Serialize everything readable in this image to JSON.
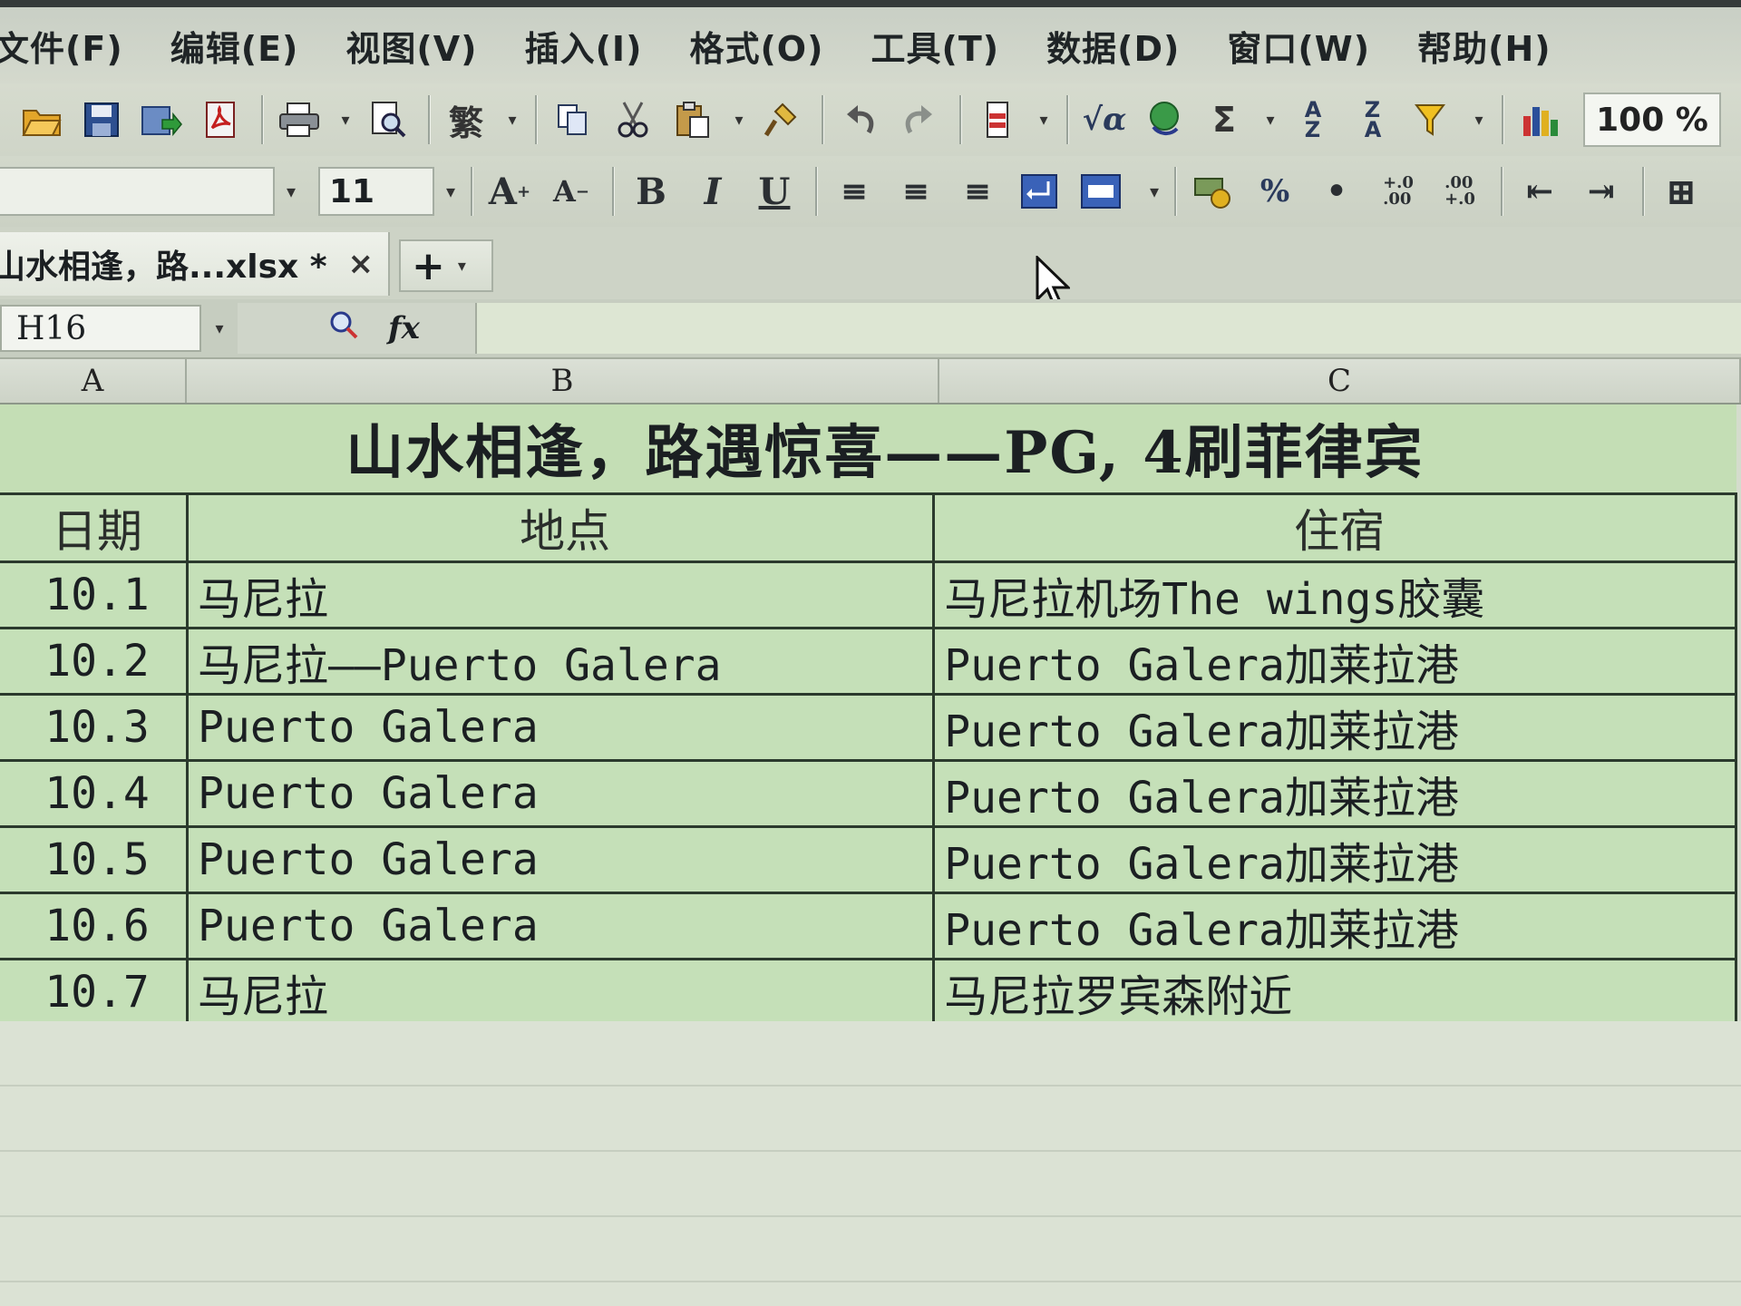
{
  "menu": {
    "items": [
      "文件(F)",
      "编辑(E)",
      "视图(V)",
      "插入(I)",
      "格式(O)",
      "工具(T)",
      "数据(D)",
      "窗口(W)",
      "帮助(H)"
    ]
  },
  "toolbar": {
    "traditional_label": "繁",
    "sigma_label": "Σ",
    "zoom": "100 %"
  },
  "format_toolbar": {
    "font_name": "",
    "font_size": "11",
    "bold_label": "B",
    "italic_label": "I",
    "underline_label": "U",
    "percent_label": "%"
  },
  "tab": {
    "title": "山水相逢，路...xlsx *",
    "close_label": "×",
    "new_label": "+"
  },
  "formula_bar": {
    "cell_ref": "H16",
    "fx_label": "fx",
    "content": ""
  },
  "columns": [
    "A",
    "B",
    "C"
  ],
  "sheet": {
    "title": "山水相逢，路遇惊喜——PG, 4刷菲律宾",
    "headers": [
      "日期",
      "地点",
      "住宿"
    ],
    "rows": [
      {
        "date": "10.1",
        "place": "马尼拉",
        "stay": "马尼拉机场The wings胶囊"
      },
      {
        "date": "10.2",
        "place": "马尼拉——Puerto Galera",
        "stay": "Puerto Galera加莱拉港"
      },
      {
        "date": "10.3",
        "place": "Puerto Galera",
        "stay": "Puerto Galera加莱拉港"
      },
      {
        "date": "10.4",
        "place": "Puerto Galera",
        "stay": "Puerto Galera加莱拉港"
      },
      {
        "date": "10.5",
        "place": "Puerto Galera",
        "stay": "Puerto Galera加莱拉港"
      },
      {
        "date": "10.6",
        "place": "Puerto Galera",
        "stay": "Puerto Galera加莱拉港"
      },
      {
        "date": "10.7",
        "place": "马尼拉",
        "stay": "马尼拉罗宾森附近"
      }
    ]
  },
  "colors": {
    "cell_fill": "#c5e0b8",
    "border": "#2b3a2d"
  }
}
